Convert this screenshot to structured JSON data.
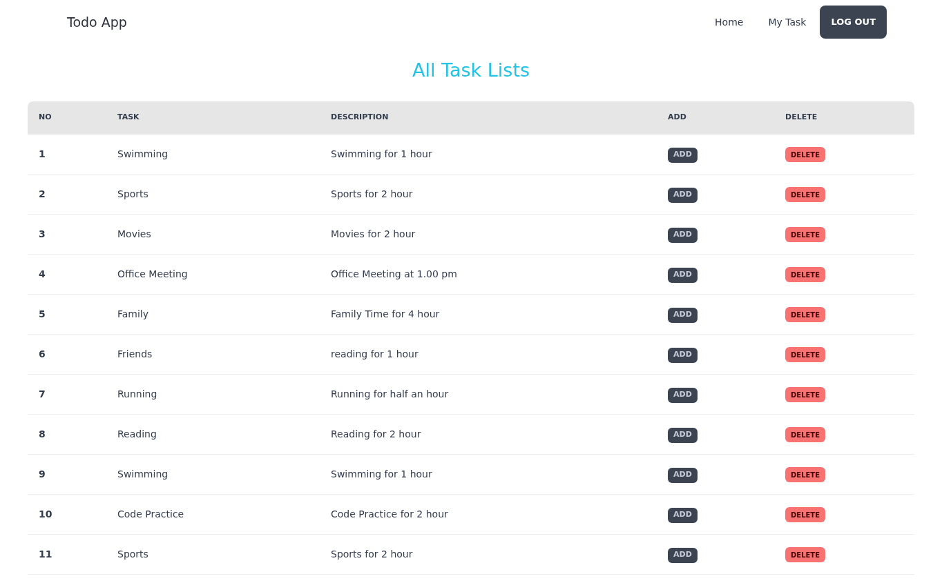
{
  "navbar": {
    "brand": "Todo App",
    "links": [
      "Home",
      "My Task"
    ],
    "logout": "LOG OUT"
  },
  "title": "All Task Lists",
  "table": {
    "columns": [
      "NO",
      "TASK",
      "DESCRIPTION",
      "ADD",
      "DELETE"
    ],
    "rows": [
      {
        "no": "1",
        "task": "Swimming",
        "description": "Swimming for 1 hour",
        "add": "ADD",
        "delete": "DELETE"
      },
      {
        "no": "2",
        "task": "Sports",
        "description": "Sports for 2 hour",
        "add": "ADD",
        "delete": "DELETE"
      },
      {
        "no": "3",
        "task": "Movies",
        "description": "Movies for 2 hour",
        "add": "ADD",
        "delete": "DELETE"
      },
      {
        "no": "4",
        "task": "Office Meeting",
        "description": "Office Meeting at 1.00 pm",
        "add": "ADD",
        "delete": "DELETE"
      },
      {
        "no": "5",
        "task": "Family",
        "description": "Family Time for 4 hour",
        "add": "ADD",
        "delete": "DELETE"
      },
      {
        "no": "6",
        "task": "Friends",
        "description": "reading for 1 hour",
        "add": "ADD",
        "delete": "DELETE"
      },
      {
        "no": "7",
        "task": "Running",
        "description": "Running for half an hour",
        "add": "ADD",
        "delete": "DELETE"
      },
      {
        "no": "8",
        "task": "Reading",
        "description": "Reading for 2 hour",
        "add": "ADD",
        "delete": "DELETE"
      },
      {
        "no": "9",
        "task": "Swimming",
        "description": "Swimming for 1 hour",
        "add": "ADD",
        "delete": "DELETE"
      },
      {
        "no": "10",
        "task": "Code Practice",
        "description": "Code Practice for 2 hour",
        "add": "ADD",
        "delete": "DELETE"
      },
      {
        "no": "11",
        "task": "Sports",
        "description": "Sports for 2 hour",
        "add": "ADD",
        "delete": "DELETE"
      }
    ]
  }
}
